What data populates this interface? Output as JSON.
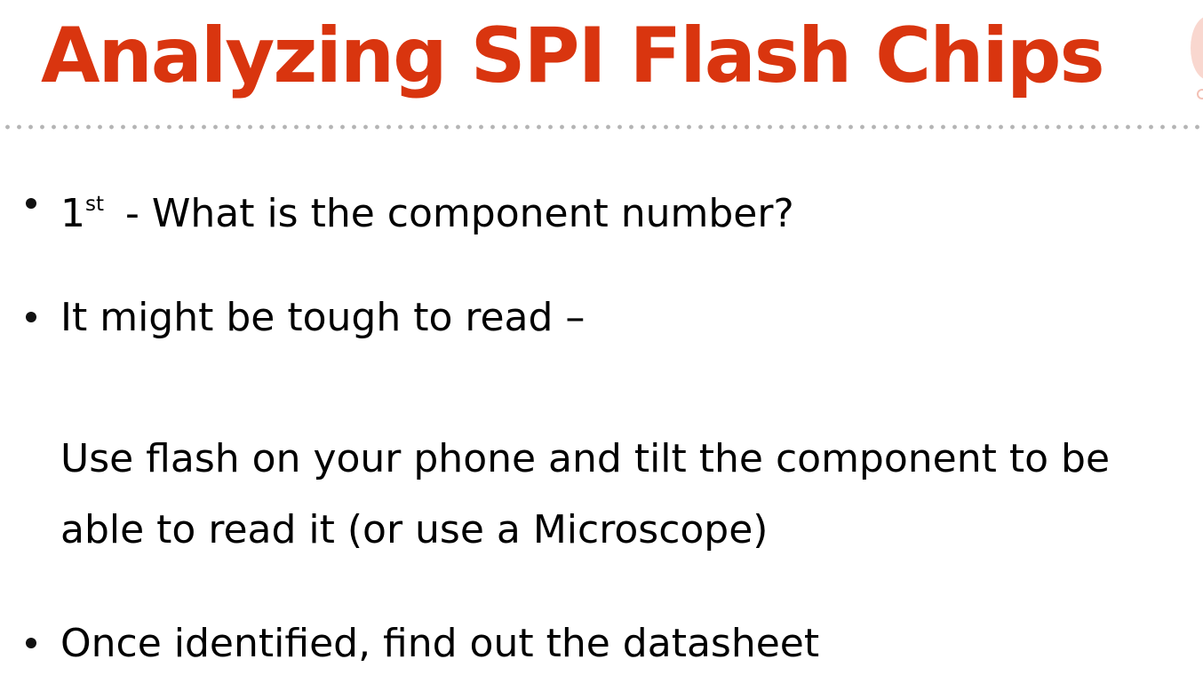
{
  "slide": {
    "title": "Analyzing SPI Flash Chips",
    "title_color": "#d9350f",
    "bullets": [
      {
        "number": "1",
        "superscript": "st",
        "text": " - What is the component number?"
      },
      {
        "text": "It might be tough to read –"
      },
      {
        "text": "Once identified, find out the datasheet"
      }
    ],
    "sub_paragraph": {
      "line1": "Use flash on your phone and tilt the component to be",
      "line2": "able to read it (or use a Microscope)"
    }
  }
}
